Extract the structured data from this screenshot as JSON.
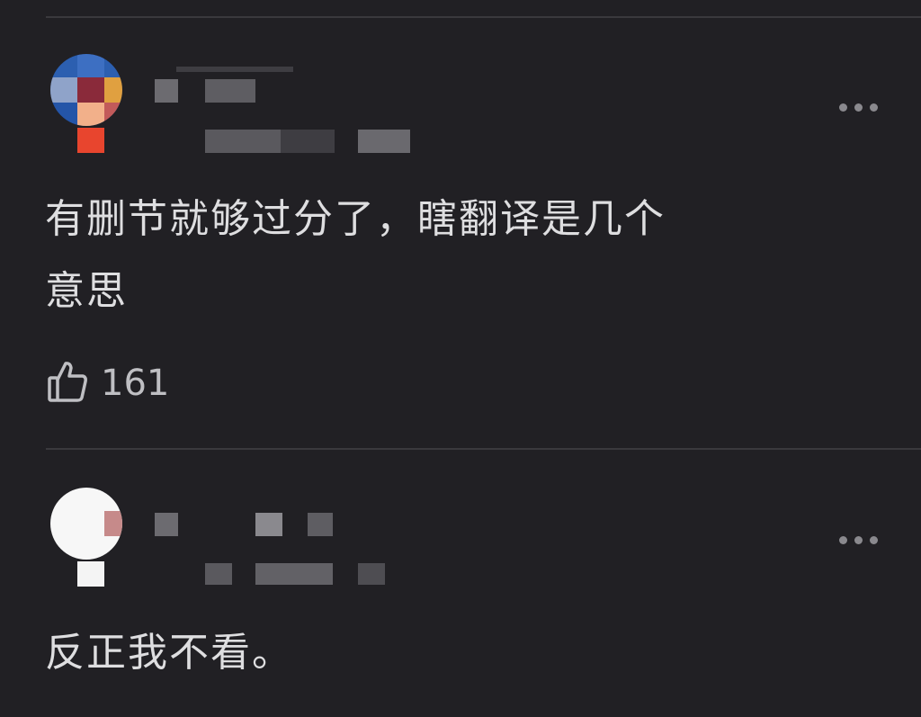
{
  "comments": [
    {
      "text_line1": "有删节就够过分了，瞎翻译是几个",
      "text_line2": "意思",
      "likes": "161",
      "avatar_icon": "pixelated-avatar-icon",
      "more_icon": "more-options-icon",
      "like_icon": "thumbs-up-icon"
    },
    {
      "text_line1": "反正我不看。",
      "avatar_icon": "pixelated-avatar-icon",
      "more_icon": "more-options-icon"
    }
  ],
  "colors": {
    "background": "#212024",
    "text": "#dedee0",
    "divider": "#3a393d"
  }
}
